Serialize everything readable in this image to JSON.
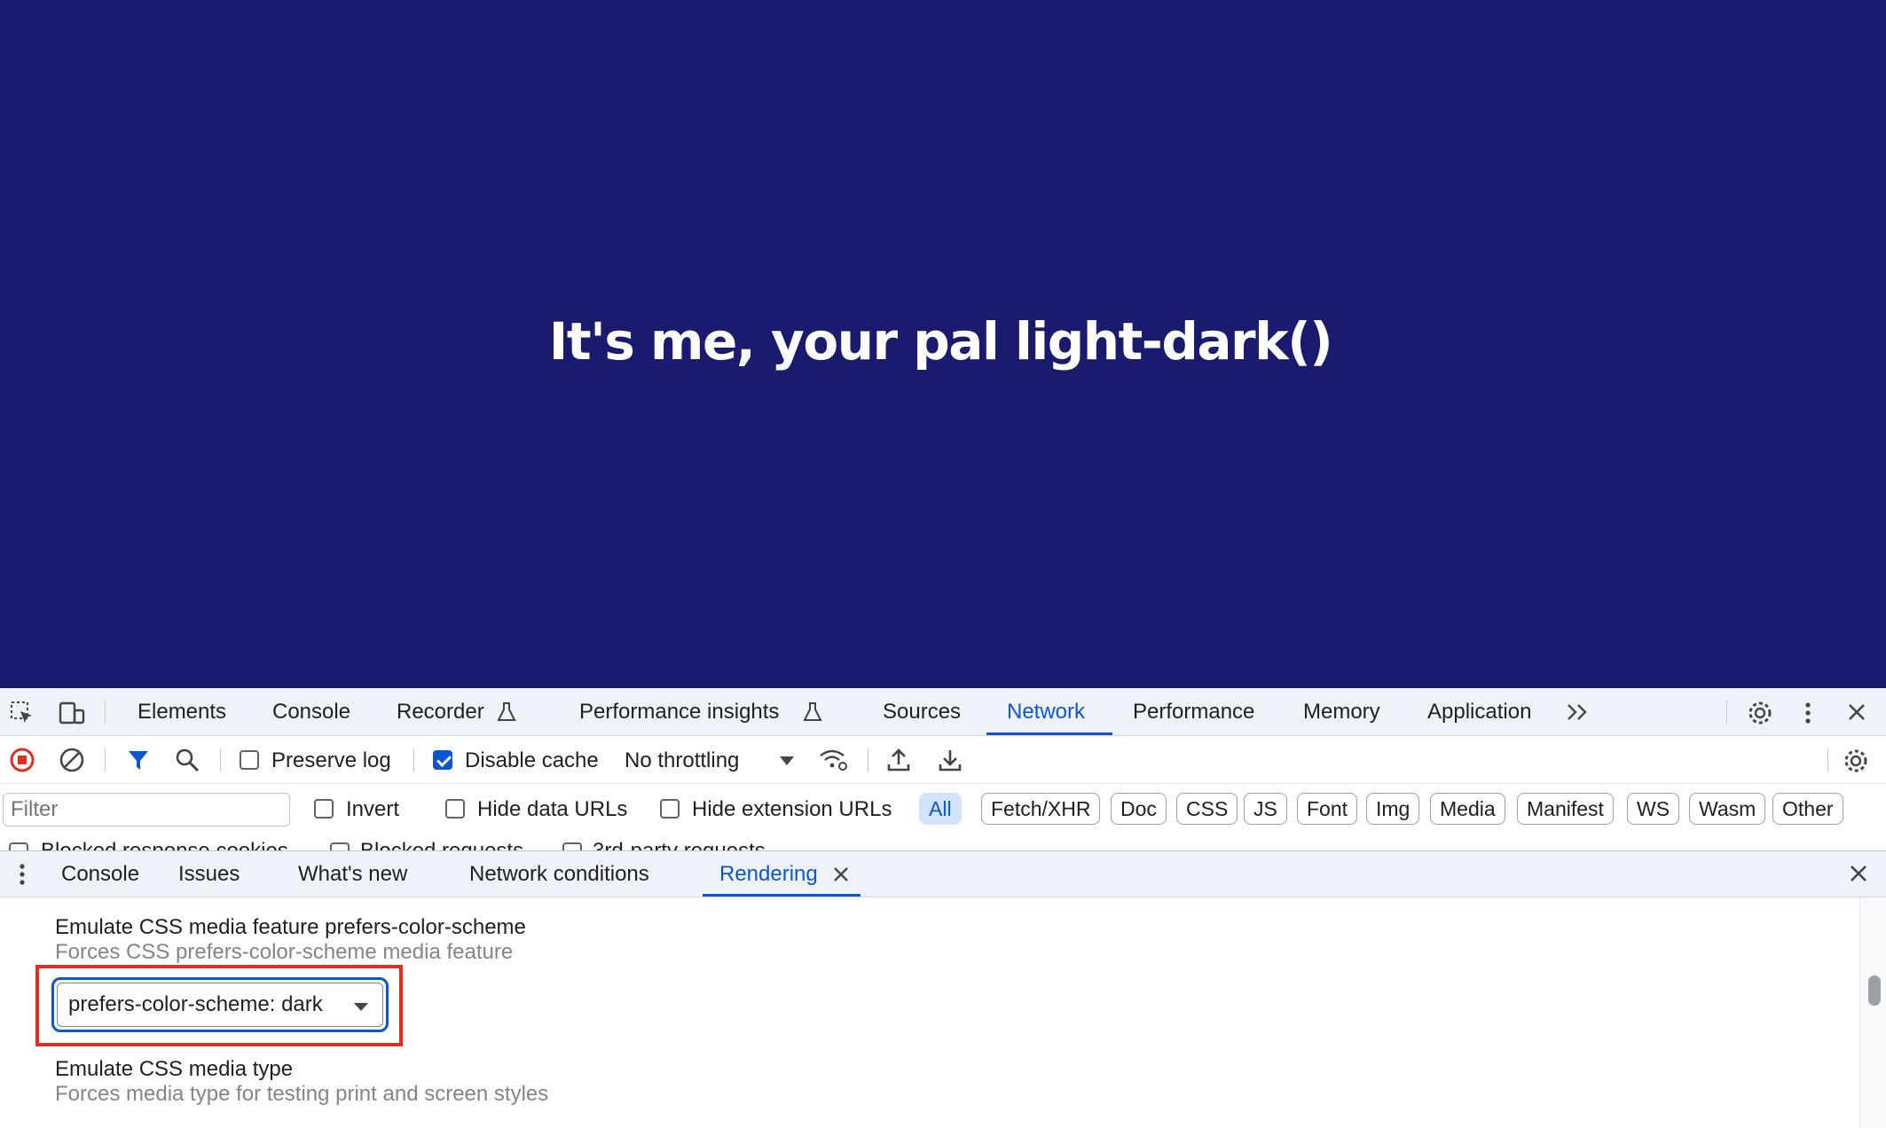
{
  "page": {
    "heading": "It's me, your pal light-dark()",
    "background": "#1a1a6e"
  },
  "devtools": {
    "main_tabs": [
      "Elements",
      "Console",
      "Recorder",
      "Performance insights",
      "Sources",
      "Network",
      "Performance",
      "Memory",
      "Application"
    ],
    "active_main_tab": "Network",
    "toolbar": {
      "preserve_log_label": "Preserve log",
      "preserve_log_checked": false,
      "disable_cache_label": "Disable cache",
      "disable_cache_checked": true,
      "throttling_value": "No throttling"
    },
    "filter": {
      "placeholder": "Filter",
      "invert_label": "Invert",
      "hide_data_urls_label": "Hide data URLs",
      "hide_extension_urls_label": "Hide extension URLs",
      "types": [
        "All",
        "Fetch/XHR",
        "Doc",
        "CSS",
        "JS",
        "Font",
        "Img",
        "Media",
        "Manifest",
        "WS",
        "Wasm",
        "Other"
      ],
      "active_type": "All"
    },
    "overflow_row": {
      "blocked_response_cookies": "Blocked response cookies",
      "blocked_requests": "Blocked requests",
      "third_party_requests": "3rd-party requests"
    },
    "drawer": {
      "tabs": [
        "Console",
        "Issues",
        "What's new",
        "Network conditions",
        "Rendering"
      ],
      "active_tab": "Rendering"
    },
    "rendering": {
      "color_scheme_title": "Emulate CSS media feature prefers-color-scheme",
      "color_scheme_subtitle": "Forces CSS prefers-color-scheme media feature",
      "color_scheme_value": "prefers-color-scheme: dark",
      "media_type_title": "Emulate CSS media type",
      "media_type_subtitle": "Forces media type for testing print and screen styles"
    },
    "colors": {
      "accent": "#0b57d0",
      "highlight": "#e02d1f",
      "record": "#d93025"
    }
  }
}
